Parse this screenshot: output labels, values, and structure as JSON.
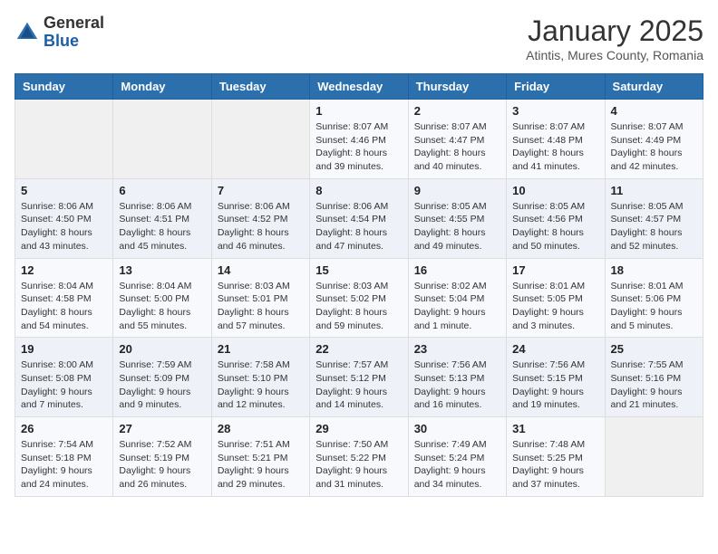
{
  "header": {
    "logo_line1": "General",
    "logo_line2": "Blue",
    "month": "January 2025",
    "location": "Atintis, Mures County, Romania"
  },
  "weekdays": [
    "Sunday",
    "Monday",
    "Tuesday",
    "Wednesday",
    "Thursday",
    "Friday",
    "Saturday"
  ],
  "weeks": [
    [
      {
        "day": "",
        "sunrise": "",
        "sunset": "",
        "daylight": ""
      },
      {
        "day": "",
        "sunrise": "",
        "sunset": "",
        "daylight": ""
      },
      {
        "day": "",
        "sunrise": "",
        "sunset": "",
        "daylight": ""
      },
      {
        "day": "1",
        "sunrise": "Sunrise: 8:07 AM",
        "sunset": "Sunset: 4:46 PM",
        "daylight": "Daylight: 8 hours and 39 minutes."
      },
      {
        "day": "2",
        "sunrise": "Sunrise: 8:07 AM",
        "sunset": "Sunset: 4:47 PM",
        "daylight": "Daylight: 8 hours and 40 minutes."
      },
      {
        "day": "3",
        "sunrise": "Sunrise: 8:07 AM",
        "sunset": "Sunset: 4:48 PM",
        "daylight": "Daylight: 8 hours and 41 minutes."
      },
      {
        "day": "4",
        "sunrise": "Sunrise: 8:07 AM",
        "sunset": "Sunset: 4:49 PM",
        "daylight": "Daylight: 8 hours and 42 minutes."
      }
    ],
    [
      {
        "day": "5",
        "sunrise": "Sunrise: 8:06 AM",
        "sunset": "Sunset: 4:50 PM",
        "daylight": "Daylight: 8 hours and 43 minutes."
      },
      {
        "day": "6",
        "sunrise": "Sunrise: 8:06 AM",
        "sunset": "Sunset: 4:51 PM",
        "daylight": "Daylight: 8 hours and 45 minutes."
      },
      {
        "day": "7",
        "sunrise": "Sunrise: 8:06 AM",
        "sunset": "Sunset: 4:52 PM",
        "daylight": "Daylight: 8 hours and 46 minutes."
      },
      {
        "day": "8",
        "sunrise": "Sunrise: 8:06 AM",
        "sunset": "Sunset: 4:54 PM",
        "daylight": "Daylight: 8 hours and 47 minutes."
      },
      {
        "day": "9",
        "sunrise": "Sunrise: 8:05 AM",
        "sunset": "Sunset: 4:55 PM",
        "daylight": "Daylight: 8 hours and 49 minutes."
      },
      {
        "day": "10",
        "sunrise": "Sunrise: 8:05 AM",
        "sunset": "Sunset: 4:56 PM",
        "daylight": "Daylight: 8 hours and 50 minutes."
      },
      {
        "day": "11",
        "sunrise": "Sunrise: 8:05 AM",
        "sunset": "Sunset: 4:57 PM",
        "daylight": "Daylight: 8 hours and 52 minutes."
      }
    ],
    [
      {
        "day": "12",
        "sunrise": "Sunrise: 8:04 AM",
        "sunset": "Sunset: 4:58 PM",
        "daylight": "Daylight: 8 hours and 54 minutes."
      },
      {
        "day": "13",
        "sunrise": "Sunrise: 8:04 AM",
        "sunset": "Sunset: 5:00 PM",
        "daylight": "Daylight: 8 hours and 55 minutes."
      },
      {
        "day": "14",
        "sunrise": "Sunrise: 8:03 AM",
        "sunset": "Sunset: 5:01 PM",
        "daylight": "Daylight: 8 hours and 57 minutes."
      },
      {
        "day": "15",
        "sunrise": "Sunrise: 8:03 AM",
        "sunset": "Sunset: 5:02 PM",
        "daylight": "Daylight: 8 hours and 59 minutes."
      },
      {
        "day": "16",
        "sunrise": "Sunrise: 8:02 AM",
        "sunset": "Sunset: 5:04 PM",
        "daylight": "Daylight: 9 hours and 1 minute."
      },
      {
        "day": "17",
        "sunrise": "Sunrise: 8:01 AM",
        "sunset": "Sunset: 5:05 PM",
        "daylight": "Daylight: 9 hours and 3 minutes."
      },
      {
        "day": "18",
        "sunrise": "Sunrise: 8:01 AM",
        "sunset": "Sunset: 5:06 PM",
        "daylight": "Daylight: 9 hours and 5 minutes."
      }
    ],
    [
      {
        "day": "19",
        "sunrise": "Sunrise: 8:00 AM",
        "sunset": "Sunset: 5:08 PM",
        "daylight": "Daylight: 9 hours and 7 minutes."
      },
      {
        "day": "20",
        "sunrise": "Sunrise: 7:59 AM",
        "sunset": "Sunset: 5:09 PM",
        "daylight": "Daylight: 9 hours and 9 minutes."
      },
      {
        "day": "21",
        "sunrise": "Sunrise: 7:58 AM",
        "sunset": "Sunset: 5:10 PM",
        "daylight": "Daylight: 9 hours and 12 minutes."
      },
      {
        "day": "22",
        "sunrise": "Sunrise: 7:57 AM",
        "sunset": "Sunset: 5:12 PM",
        "daylight": "Daylight: 9 hours and 14 minutes."
      },
      {
        "day": "23",
        "sunrise": "Sunrise: 7:56 AM",
        "sunset": "Sunset: 5:13 PM",
        "daylight": "Daylight: 9 hours and 16 minutes."
      },
      {
        "day": "24",
        "sunrise": "Sunrise: 7:56 AM",
        "sunset": "Sunset: 5:15 PM",
        "daylight": "Daylight: 9 hours and 19 minutes."
      },
      {
        "day": "25",
        "sunrise": "Sunrise: 7:55 AM",
        "sunset": "Sunset: 5:16 PM",
        "daylight": "Daylight: 9 hours and 21 minutes."
      }
    ],
    [
      {
        "day": "26",
        "sunrise": "Sunrise: 7:54 AM",
        "sunset": "Sunset: 5:18 PM",
        "daylight": "Daylight: 9 hours and 24 minutes."
      },
      {
        "day": "27",
        "sunrise": "Sunrise: 7:52 AM",
        "sunset": "Sunset: 5:19 PM",
        "daylight": "Daylight: 9 hours and 26 minutes."
      },
      {
        "day": "28",
        "sunrise": "Sunrise: 7:51 AM",
        "sunset": "Sunset: 5:21 PM",
        "daylight": "Daylight: 9 hours and 29 minutes."
      },
      {
        "day": "29",
        "sunrise": "Sunrise: 7:50 AM",
        "sunset": "Sunset: 5:22 PM",
        "daylight": "Daylight: 9 hours and 31 minutes."
      },
      {
        "day": "30",
        "sunrise": "Sunrise: 7:49 AM",
        "sunset": "Sunset: 5:24 PM",
        "daylight": "Daylight: 9 hours and 34 minutes."
      },
      {
        "day": "31",
        "sunrise": "Sunrise: 7:48 AM",
        "sunset": "Sunset: 5:25 PM",
        "daylight": "Daylight: 9 hours and 37 minutes."
      },
      {
        "day": "",
        "sunrise": "",
        "sunset": "",
        "daylight": ""
      }
    ]
  ]
}
